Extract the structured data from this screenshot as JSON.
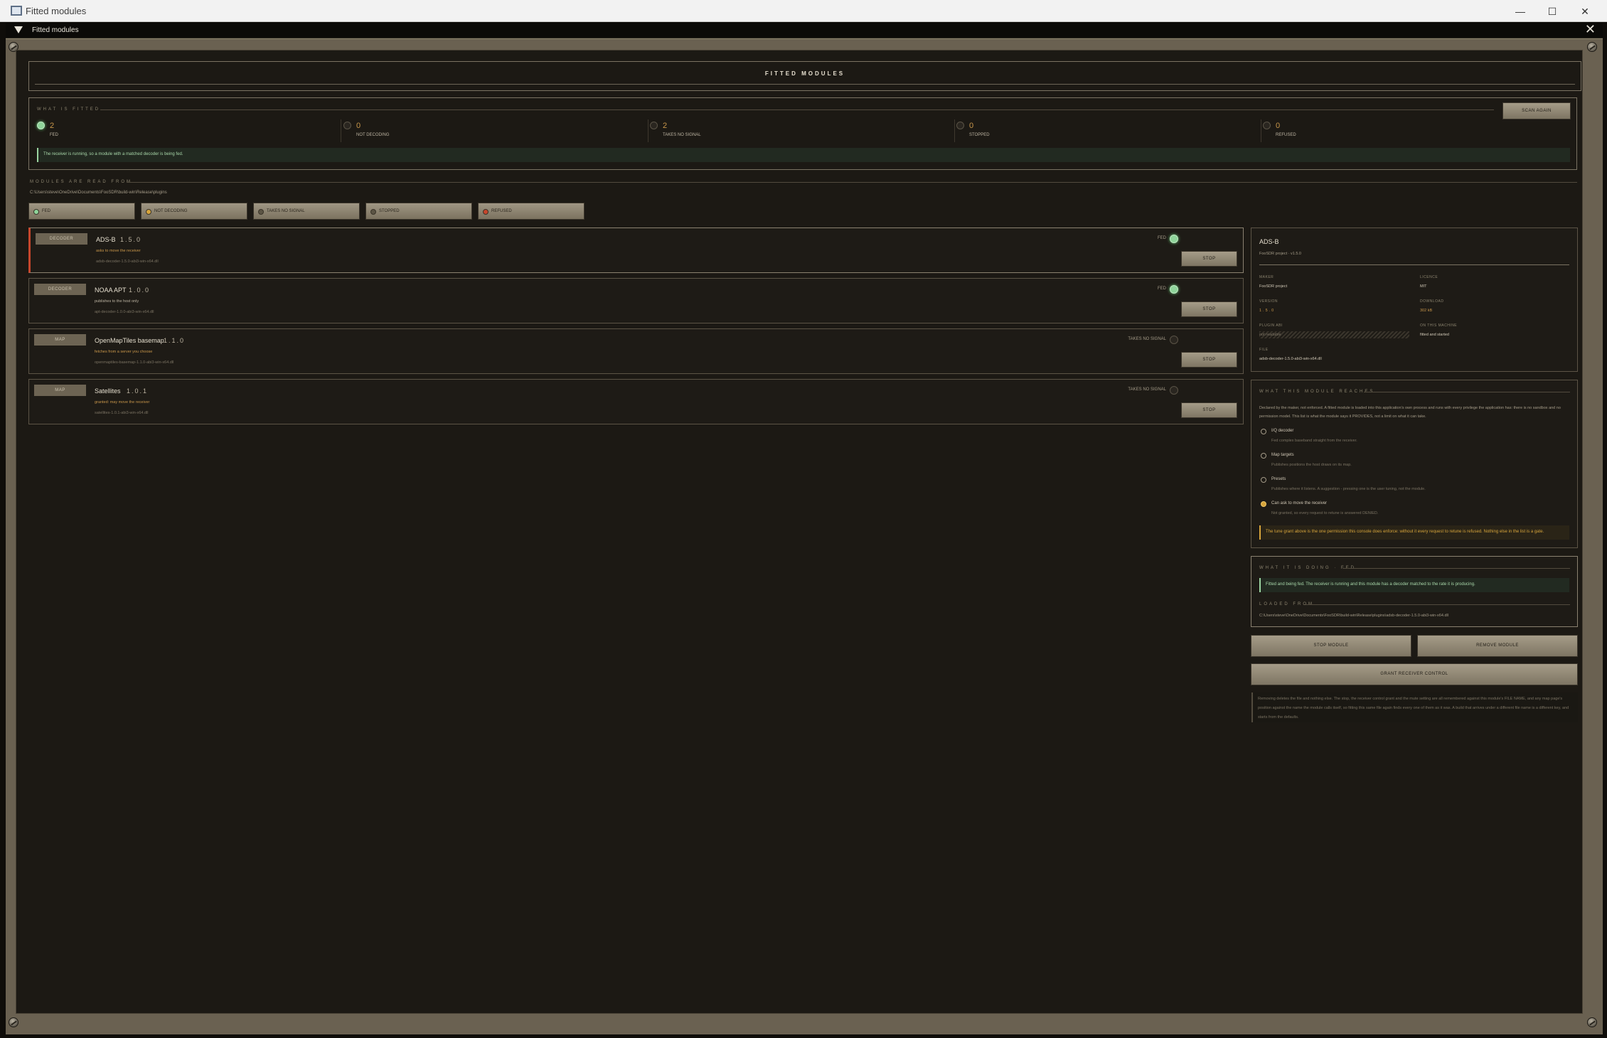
{
  "window": {
    "title": "Fitted modules"
  },
  "dock": {
    "title": "Fitted modules"
  },
  "header": {
    "title": "FITTED MODULES"
  },
  "what_is_fitted": {
    "label": "WHAT IS FITTED",
    "scan_button": "SCAN AGAIN",
    "stats": [
      {
        "count": "2",
        "label": "FED"
      },
      {
        "count": "0",
        "label": "NOT DECODING"
      },
      {
        "count": "2",
        "label": "TAKES NO SIGNAL"
      },
      {
        "count": "0",
        "label": "STOPPED"
      },
      {
        "count": "0",
        "label": "REFUSED"
      }
    ],
    "banner": "The receiver is running, so a module with a matched decoder is being fed."
  },
  "read_from": {
    "label": "MODULES ARE READ FROM",
    "path": "C:\\Users\\steve\\OneDrive\\Documents\\FooSDR\\build-win\\Release\\plugins"
  },
  "filters": [
    "FED",
    "NOT DECODING",
    "TAKES NO SIGNAL",
    "STOPPED",
    "REFUSED"
  ],
  "modules": [
    {
      "kind": "DECODER",
      "name": "ADS-B",
      "version": "1.5.0",
      "note": "asks to move the receiver",
      "file": "adsb-decoder-1.5.0-abi3-win-x64.dll",
      "status": "FED",
      "stop": "STOP"
    },
    {
      "kind": "DECODER",
      "name": "NOAA APT",
      "version": "1.0.0",
      "note": "publishes to the host only",
      "file": "apt-decoder-1.0.0-abi3-win-x64.dll",
      "status": "FED",
      "stop": "STOP"
    },
    {
      "kind": "MAP",
      "name": "OpenMapTiles basemap",
      "version": "1.1.0",
      "note": "fetches from a server you choose",
      "file": "openmaptiles-basemap-1.1.0-abi3-win-x64.dll",
      "status": "TAKES NO SIGNAL",
      "stop": "STOP"
    },
    {
      "kind": "MAP",
      "name": "Satellites",
      "version": "1.0.1",
      "note": "granted: may move the receiver",
      "file": "satellites-1.0.1-abi3-win-x64.dll",
      "status": "TAKES NO SIGNAL",
      "stop": "STOP"
    }
  ],
  "detail": {
    "name": "ADS-B",
    "sub": "FooSDR project · v1.5.0",
    "maker_label": "MAKER",
    "maker": "FooSDR project",
    "licence_label": "LICENCE",
    "licence": "MIT",
    "version_label": "VERSION",
    "version": "1.5.0",
    "download_label": "DOWNLOAD",
    "download": "302 kB",
    "plugin_abi_label": "PLUGIN ABI",
    "plugin_abi": "not readable",
    "machine_label": "ON THIS MACHINE",
    "machine": "fitted and started",
    "file_label": "FILE",
    "file": "adsb-decoder-1.5.0-abi3-win-x64.dll"
  },
  "reaches": {
    "label": "WHAT THIS MODULE REACHES",
    "intro": "Declared by the maker, not enforced. A fitted module is loaded into this application's own process and runs with every privilege the application has: there is no sandbox and no permission model. This list is what the module says it PROVIDES, not a limit on what it can take.",
    "items": [
      {
        "title": "I/Q decoder",
        "sub": "Fed complex baseband straight from the receiver."
      },
      {
        "title": "Map targets",
        "sub": "Publishes positions the host draws on its map."
      },
      {
        "title": "Presets",
        "sub": "Publishes where it listens. A suggestion - pressing one is the user tuning, not the module."
      },
      {
        "title": "Can ask to move the receiver",
        "sub": "Not granted, so every request to retune is answered DENIED."
      }
    ],
    "warning": "The tune grant above is the one permission this console does enforce: without it every request to retune is refused. Nothing else in the list is a gate."
  },
  "doing": {
    "label": "WHAT IT IS DOING · FED",
    "banner": "Fitted and being fed. The receiver is running and this module has a decoder matched to the rate it is producing.",
    "loaded_label": "LOADED FROM",
    "loaded_path": "C:\\Users\\steve\\OneDrive\\Documents\\FooSDR\\build-win\\Release\\plugins\\adsb-decoder-1.5.0-abi3-win-x64.dll"
  },
  "actions": {
    "stop": "STOP MODULE",
    "remove": "REMOVE MODULE",
    "grant": "GRANT RECEIVER CONTROL",
    "note": "Removing deletes the file and nothing else. The stop, the receiver control grant and the mute setting are all remembered against this module's FILE NAME, and any map page's position against the name the module calls itself, so fitting this same file again finds every one of them as it was. A build that arrives under a different file name is a different key, and starts from the defaults."
  }
}
